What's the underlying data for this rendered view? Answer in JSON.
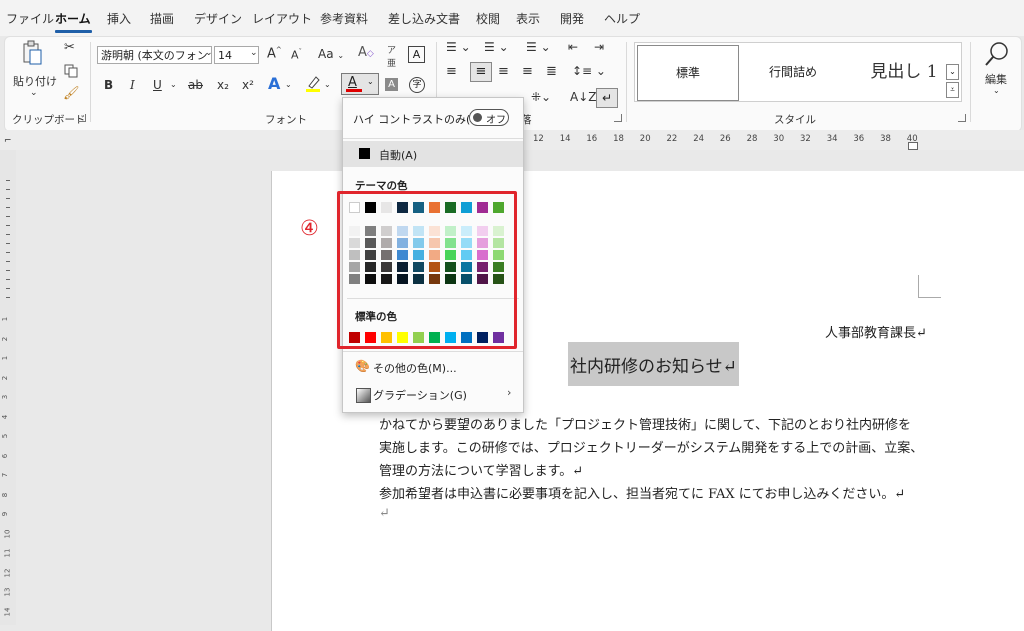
{
  "menu_tabs": [
    "ファイル",
    "ホーム",
    "挿入",
    "描画",
    "デザイン",
    "レイアウト",
    "参考資料",
    "差し込み文書",
    "校閲",
    "表示",
    "開発",
    "ヘルプ"
  ],
  "ribbon": {
    "clipboard": {
      "paste_label": "貼り付け",
      "group_label": "クリップボード"
    },
    "font": {
      "font_name": "游明朝 (本文のフォン",
      "font_size": "14",
      "bold": "B",
      "italic": "I",
      "underline": "U",
      "strike": "ab",
      "subscript": "x₂",
      "superscript": "x²",
      "grow": "A^",
      "shrink": "Aˇ",
      "case": "Aa",
      "font_color_letter": "A",
      "group_label": "フォント"
    },
    "paragraph": {
      "group_label": "落"
    },
    "styles": {
      "items": [
        "標準",
        "行間詰め",
        "見出し 1"
      ],
      "group_label": "スタイル"
    },
    "editing": {
      "label": "編集"
    }
  },
  "ruler_ticks": [
    "12",
    "14",
    "16",
    "18",
    "20",
    "22",
    "24",
    "26",
    "28",
    "30",
    "32",
    "34",
    "36",
    "38",
    "40"
  ],
  "vruler_ticks": [
    "1",
    "2",
    "1",
    "2",
    "3",
    "4",
    "5",
    "6",
    "7",
    "8",
    "9",
    "10",
    "11",
    "12",
    "13",
    "14"
  ],
  "document": {
    "sender": "人事部教育課長↵",
    "title": "社内研修のお知らせ↵",
    "lines": [
      "かねてから要望のありました「プロジェクト管理技術」に関して、下記のとおり社内研修を",
      "実施します。この研修では、プロジェクトリーダーがシステム開発をする上での計画、立案、",
      "管理の方法について学習します。↵",
      "参加希望者は申込書に必要事項を記入し、担当者宛てに FAX にてお申し込みください。↵",
      "↵"
    ]
  },
  "color_menu": {
    "high_contrast_label": "ハイ コントラストのみ(H)",
    "toggle_state": "オフ",
    "auto_label": "自動(A)",
    "theme_header": "テーマの色",
    "standard_header": "標準の色",
    "more_colors_label": "その他の色(M)...",
    "gradient_label": "グラデーション(G)",
    "theme_colors": [
      "#ffffff",
      "#000000",
      "#e7e6e6",
      "#0e2841",
      "#156082",
      "#e97132",
      "#196b24",
      "#0f9ed5",
      "#a02b93",
      "#4ea72e"
    ],
    "theme_shades": [
      [
        "#f2f2f2",
        "#d9d9d9",
        "#bfbfbf",
        "#a6a6a6",
        "#808080"
      ],
      [
        "#7f7f7f",
        "#595959",
        "#404040",
        "#262626",
        "#0d0d0d"
      ],
      [
        "#d0cece",
        "#afabab",
        "#757070",
        "#3a3838",
        "#171616"
      ],
      [
        "#c0d8f0",
        "#82b1e0",
        "#3f89d1",
        "#0a1e31",
        "#061421"
      ],
      [
        "#c1e4f5",
        "#83caeb",
        "#45b0e1",
        "#104861",
        "#0b3041"
      ],
      [
        "#fbe2d5",
        "#f6c6ad",
        "#f2aa84",
        "#b35414",
        "#77380d"
      ],
      [
        "#c1f0c8",
        "#83e28e",
        "#47d459",
        "#134f1b",
        "#0c3512"
      ],
      [
        "#caedfb",
        "#95dcf7",
        "#61cbf3",
        "#0b76a0",
        "#074f6a"
      ],
      [
        "#f2ceef",
        "#e59edd",
        "#d86dcd",
        "#77206d",
        "#501548"
      ],
      [
        "#d9f2d0",
        "#b4e5a2",
        "#8ed973",
        "#3a7d22",
        "#275317"
      ]
    ],
    "standard_colors": [
      "#c00000",
      "#ff0000",
      "#ffc000",
      "#ffff00",
      "#92d050",
      "#00b050",
      "#00b0f0",
      "#0070c0",
      "#002060",
      "#7030a0"
    ]
  },
  "callout": "④"
}
